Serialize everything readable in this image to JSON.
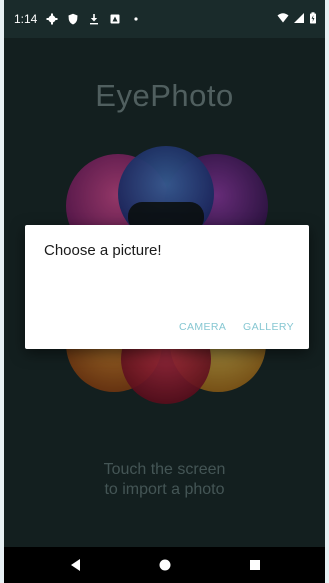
{
  "status": {
    "time": "1:14",
    "icons": [
      "gear-icon",
      "shield-icon",
      "download-icon",
      "notification-icon",
      "dot-icon"
    ],
    "right_icons": [
      "wifi-icon",
      "signal-icon",
      "battery-icon"
    ]
  },
  "app": {
    "title": "EyePhoto",
    "hint_line1": "Touch the screen",
    "hint_line2": "to import a photo"
  },
  "dialog": {
    "title": "Choose a picture!",
    "camera_label": "CAMERA",
    "gallery_label": "GALLERY"
  },
  "nav": {
    "icons": [
      "back-icon",
      "home-icon",
      "recents-icon"
    ]
  },
  "colors": {
    "background": "#1b2b2b",
    "accent": "#86c7d2"
  }
}
